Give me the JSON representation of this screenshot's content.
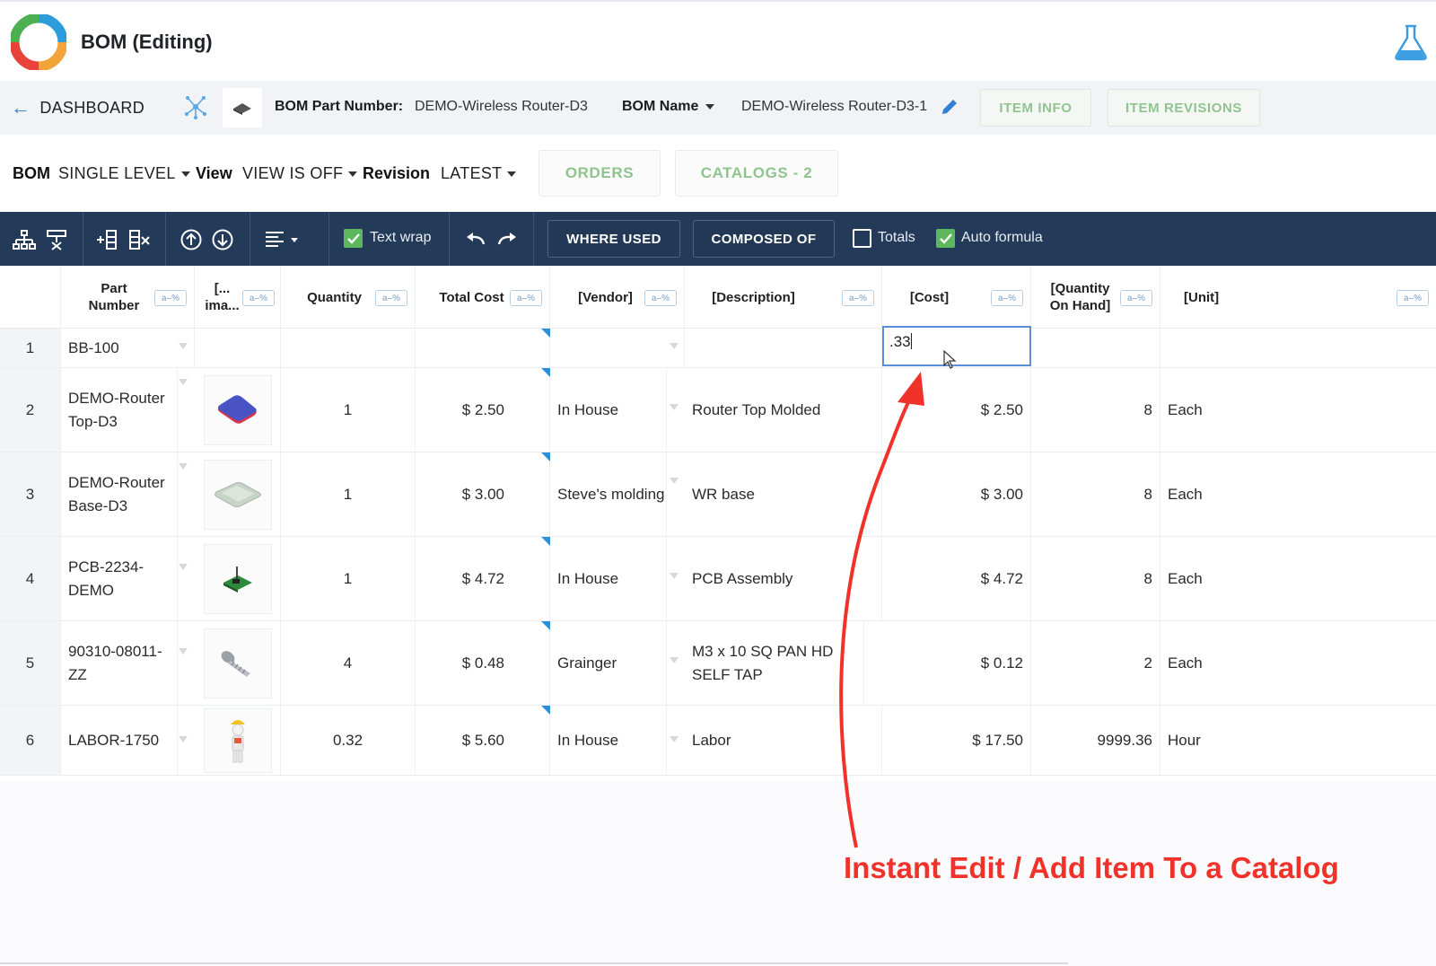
{
  "app": {
    "title": "BOM (Editing)"
  },
  "partbar": {
    "back_label": "DASHBOARD",
    "part_number_label": "BOM Part Number:",
    "part_number_value": "DEMO-Wireless Router-D3",
    "bom_name_label": "BOM Name",
    "bom_name_value": "DEMO-Wireless Router-D3-1",
    "item_info": "ITEM INFO",
    "item_revisions": "ITEM REVISIONS"
  },
  "viewbar": {
    "bom_label": "BOM",
    "bom_value": "SINGLE LEVEL",
    "view_label": "View",
    "view_value": "VIEW IS OFF",
    "revision_label": "Revision",
    "revision_value": "LATEST",
    "orders": "ORDERS",
    "catalogs": "CATALOGS - 2"
  },
  "toolbar": {
    "text_wrap": "Text wrap",
    "where_used": "WHERE USED",
    "composed_of": "COMPOSED OF",
    "totals": "Totals",
    "auto_formula": "Auto formula",
    "text_wrap_checked": true,
    "totals_checked": false,
    "auto_formula_checked": true,
    "check_color": "#5db85d",
    "bar_color": "#233a58"
  },
  "grid": {
    "filter_badge": "a–%",
    "columns": [
      {
        "l1": "Part",
        "l2": "Number"
      },
      {
        "l1": "[...",
        "l2": "ima..."
      },
      {
        "l1": "Quantity",
        "l2": ""
      },
      {
        "l1": "Total Cost",
        "l2": ""
      },
      {
        "l1": "[Vendor]",
        "l2": ""
      },
      {
        "l1": "[Description]",
        "l2": ""
      },
      {
        "l1": "[Cost]",
        "l2": ""
      },
      {
        "l1": "[Quantity",
        "l2": "On Hand]"
      },
      {
        "l1": "[Unit]",
        "l2": ""
      }
    ],
    "editing_value": ".33",
    "rows": [
      {
        "n": "1",
        "part": "BB-100",
        "img": "",
        "qty": "",
        "total": "",
        "vendor": "",
        "desc": "",
        "cost": "",
        "onhand": "",
        "unit": ""
      },
      {
        "n": "2",
        "part": "DEMO-Router Top-D3",
        "img": "router-top-image",
        "qty": "1",
        "total": "$ 2.50",
        "vendor": "In House",
        "desc": "Router Top Molded",
        "cost": "$ 2.50",
        "onhand": "8",
        "unit": "Each"
      },
      {
        "n": "3",
        "part": "DEMO-Router Base-D3",
        "img": "router-base-image",
        "qty": "1",
        "total": "$ 3.00",
        "vendor": "Steve's molding",
        "desc": "WR base",
        "cost": "$ 3.00",
        "onhand": "8",
        "unit": "Each"
      },
      {
        "n": "4",
        "part": "PCB-2234-DEMO",
        "img": "pcb-image",
        "qty": "1",
        "total": "$ 4.72",
        "vendor": "In House",
        "desc": "PCB Assembly",
        "cost": "$ 4.72",
        "onhand": "8",
        "unit": "Each"
      },
      {
        "n": "5",
        "part": "90310-08011-ZZ",
        "img": "screw-image",
        "qty": "4",
        "total": "$ 0.48",
        "vendor": "Grainger",
        "desc": "M3 x 10 SQ PAN HD SELF TAP",
        "cost": "$ 0.12",
        "onhand": "2",
        "unit": "Each"
      },
      {
        "n": "6",
        "part": "LABOR-1750",
        "img": "worker-image",
        "qty": "0.32",
        "total": "$ 5.60",
        "vendor": "In House",
        "desc": "Labor",
        "cost": "$ 17.50",
        "onhand": "9999.36",
        "unit": "Hour"
      }
    ]
  },
  "annotation": {
    "text": "Instant Edit / Add Item To a Catalog",
    "color": "#f1322a"
  }
}
